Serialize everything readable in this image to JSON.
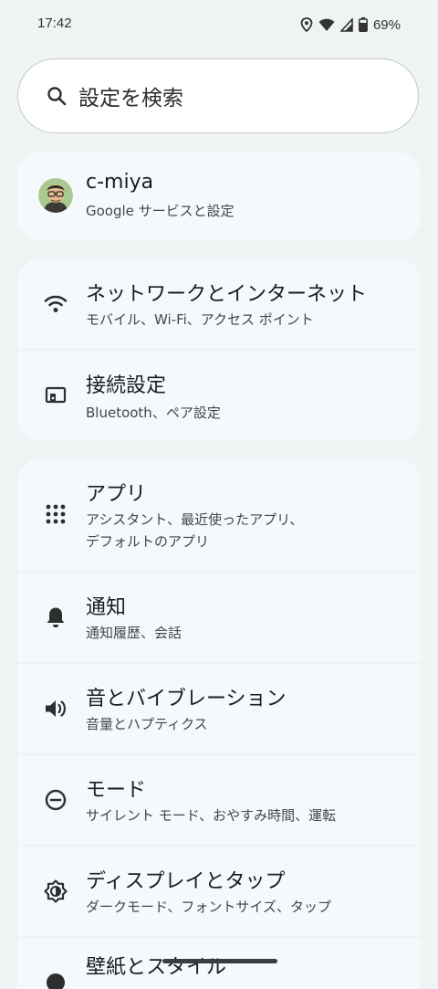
{
  "status": {
    "time": "17:42",
    "battery": "69%",
    "icons": [
      "location-icon",
      "wifi-icon",
      "signal-icon",
      "battery-icon"
    ]
  },
  "search": {
    "placeholder": "設定を検索",
    "icon": "search-icon"
  },
  "account": {
    "name": "c-miya",
    "subtitle": "Google サービスと設定"
  },
  "settings": [
    {
      "title": "ネットワークとインターネット",
      "subtitle": "モバイル、Wi-Fi、アクセス ポイント",
      "icon": "wifi-icon"
    },
    {
      "title": "接続設定",
      "subtitle": "Bluetooth、ペア設定",
      "icon": "connected-devices-icon"
    },
    {
      "title": "アプリ",
      "subtitle_line1": "アシスタント、最近使ったアプリ、",
      "subtitle_line2": "デフォルトのアプリ",
      "icon": "apps-grid-icon"
    },
    {
      "title": "通知",
      "subtitle": "通知履歴、会話",
      "icon": "bell-icon"
    },
    {
      "title": "音とバイブレーション",
      "subtitle": "音量とハプティクス",
      "icon": "volume-icon"
    },
    {
      "title": "モード",
      "subtitle": "サイレント モード、おやすみ時間、運転",
      "icon": "mode-icon"
    },
    {
      "title": "ディスプレイとタップ",
      "subtitle": "ダークモード、フォントサイズ、タップ",
      "icon": "display-brightness-icon"
    },
    {
      "title": "壁紙とスタイル",
      "icon": "wallpaper-icon"
    }
  ],
  "colors": {
    "background": "#eef3f4",
    "card": "#f5f9fb",
    "search_bg": "#ffffff"
  }
}
